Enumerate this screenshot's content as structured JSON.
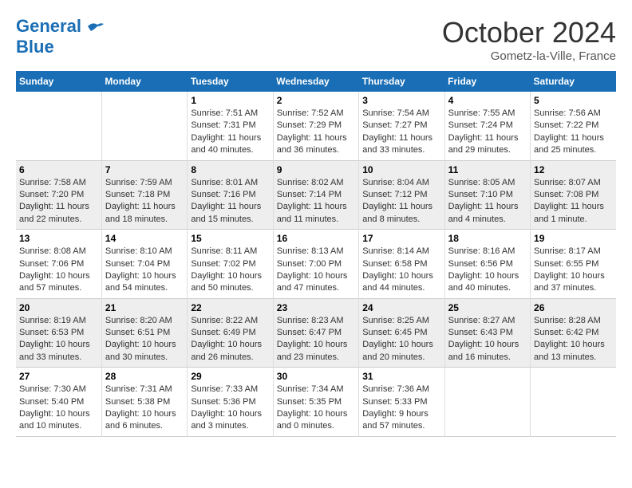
{
  "header": {
    "logo_line1": "General",
    "logo_line2": "Blue",
    "month_title": "October 2024",
    "location": "Gometz-la-Ville, France"
  },
  "columns": [
    "Sunday",
    "Monday",
    "Tuesday",
    "Wednesday",
    "Thursday",
    "Friday",
    "Saturday"
  ],
  "rows": [
    {
      "shade": "light",
      "cells": [
        {
          "day": "",
          "info": ""
        },
        {
          "day": "",
          "info": ""
        },
        {
          "day": "1",
          "info": "Sunrise: 7:51 AM\nSunset: 7:31 PM\nDaylight: 11 hours\nand 40 minutes."
        },
        {
          "day": "2",
          "info": "Sunrise: 7:52 AM\nSunset: 7:29 PM\nDaylight: 11 hours\nand 36 minutes."
        },
        {
          "day": "3",
          "info": "Sunrise: 7:54 AM\nSunset: 7:27 PM\nDaylight: 11 hours\nand 33 minutes."
        },
        {
          "day": "4",
          "info": "Sunrise: 7:55 AM\nSunset: 7:24 PM\nDaylight: 11 hours\nand 29 minutes."
        },
        {
          "day": "5",
          "info": "Sunrise: 7:56 AM\nSunset: 7:22 PM\nDaylight: 11 hours\nand 25 minutes."
        }
      ]
    },
    {
      "shade": "gray",
      "cells": [
        {
          "day": "6",
          "info": "Sunrise: 7:58 AM\nSunset: 7:20 PM\nDaylight: 11 hours\nand 22 minutes."
        },
        {
          "day": "7",
          "info": "Sunrise: 7:59 AM\nSunset: 7:18 PM\nDaylight: 11 hours\nand 18 minutes."
        },
        {
          "day": "8",
          "info": "Sunrise: 8:01 AM\nSunset: 7:16 PM\nDaylight: 11 hours\nand 15 minutes."
        },
        {
          "day": "9",
          "info": "Sunrise: 8:02 AM\nSunset: 7:14 PM\nDaylight: 11 hours\nand 11 minutes."
        },
        {
          "day": "10",
          "info": "Sunrise: 8:04 AM\nSunset: 7:12 PM\nDaylight: 11 hours\nand 8 minutes."
        },
        {
          "day": "11",
          "info": "Sunrise: 8:05 AM\nSunset: 7:10 PM\nDaylight: 11 hours\nand 4 minutes."
        },
        {
          "day": "12",
          "info": "Sunrise: 8:07 AM\nSunset: 7:08 PM\nDaylight: 11 hours\nand 1 minute."
        }
      ]
    },
    {
      "shade": "light",
      "cells": [
        {
          "day": "13",
          "info": "Sunrise: 8:08 AM\nSunset: 7:06 PM\nDaylight: 10 hours\nand 57 minutes."
        },
        {
          "day": "14",
          "info": "Sunrise: 8:10 AM\nSunset: 7:04 PM\nDaylight: 10 hours\nand 54 minutes."
        },
        {
          "day": "15",
          "info": "Sunrise: 8:11 AM\nSunset: 7:02 PM\nDaylight: 10 hours\nand 50 minutes."
        },
        {
          "day": "16",
          "info": "Sunrise: 8:13 AM\nSunset: 7:00 PM\nDaylight: 10 hours\nand 47 minutes."
        },
        {
          "day": "17",
          "info": "Sunrise: 8:14 AM\nSunset: 6:58 PM\nDaylight: 10 hours\nand 44 minutes."
        },
        {
          "day": "18",
          "info": "Sunrise: 8:16 AM\nSunset: 6:56 PM\nDaylight: 10 hours\nand 40 minutes."
        },
        {
          "day": "19",
          "info": "Sunrise: 8:17 AM\nSunset: 6:55 PM\nDaylight: 10 hours\nand 37 minutes."
        }
      ]
    },
    {
      "shade": "gray",
      "cells": [
        {
          "day": "20",
          "info": "Sunrise: 8:19 AM\nSunset: 6:53 PM\nDaylight: 10 hours\nand 33 minutes."
        },
        {
          "day": "21",
          "info": "Sunrise: 8:20 AM\nSunset: 6:51 PM\nDaylight: 10 hours\nand 30 minutes."
        },
        {
          "day": "22",
          "info": "Sunrise: 8:22 AM\nSunset: 6:49 PM\nDaylight: 10 hours\nand 26 minutes."
        },
        {
          "day": "23",
          "info": "Sunrise: 8:23 AM\nSunset: 6:47 PM\nDaylight: 10 hours\nand 23 minutes."
        },
        {
          "day": "24",
          "info": "Sunrise: 8:25 AM\nSunset: 6:45 PM\nDaylight: 10 hours\nand 20 minutes."
        },
        {
          "day": "25",
          "info": "Sunrise: 8:27 AM\nSunset: 6:43 PM\nDaylight: 10 hours\nand 16 minutes."
        },
        {
          "day": "26",
          "info": "Sunrise: 8:28 AM\nSunset: 6:42 PM\nDaylight: 10 hours\nand 13 minutes."
        }
      ]
    },
    {
      "shade": "light",
      "cells": [
        {
          "day": "27",
          "info": "Sunrise: 7:30 AM\nSunset: 5:40 PM\nDaylight: 10 hours\nand 10 minutes."
        },
        {
          "day": "28",
          "info": "Sunrise: 7:31 AM\nSunset: 5:38 PM\nDaylight: 10 hours\nand 6 minutes."
        },
        {
          "day": "29",
          "info": "Sunrise: 7:33 AM\nSunset: 5:36 PM\nDaylight: 10 hours\nand 3 minutes."
        },
        {
          "day": "30",
          "info": "Sunrise: 7:34 AM\nSunset: 5:35 PM\nDaylight: 10 hours\nand 0 minutes."
        },
        {
          "day": "31",
          "info": "Sunrise: 7:36 AM\nSunset: 5:33 PM\nDaylight: 9 hours\nand 57 minutes."
        },
        {
          "day": "",
          "info": ""
        },
        {
          "day": "",
          "info": ""
        }
      ]
    }
  ]
}
